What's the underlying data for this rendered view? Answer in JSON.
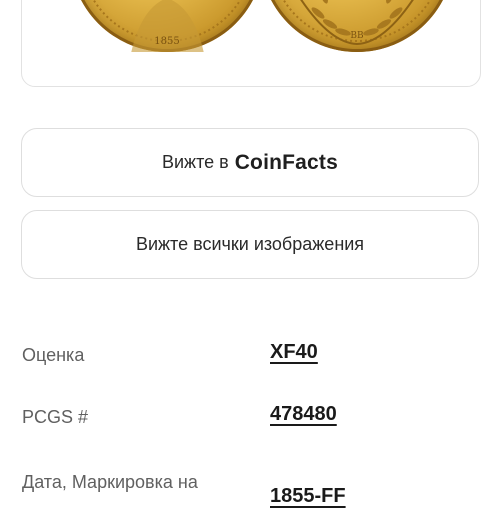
{
  "coin_image": {
    "obverse_alt": "obverse",
    "reverse_alt": "reverse",
    "gold_color": "#d9ad3f"
  },
  "buttons": {
    "coinfacts_prefix": "Вижте в",
    "coinfacts_brand": "CoinFacts",
    "all_images": "Вижте всички изображения"
  },
  "details": {
    "grade_label": "Оценка",
    "grade_value": "XF40",
    "pcgs_label": "PCGS #",
    "pcgs_value": "478480",
    "date_label": "Дата, Маркировка на",
    "date_value": "1855-FF"
  }
}
